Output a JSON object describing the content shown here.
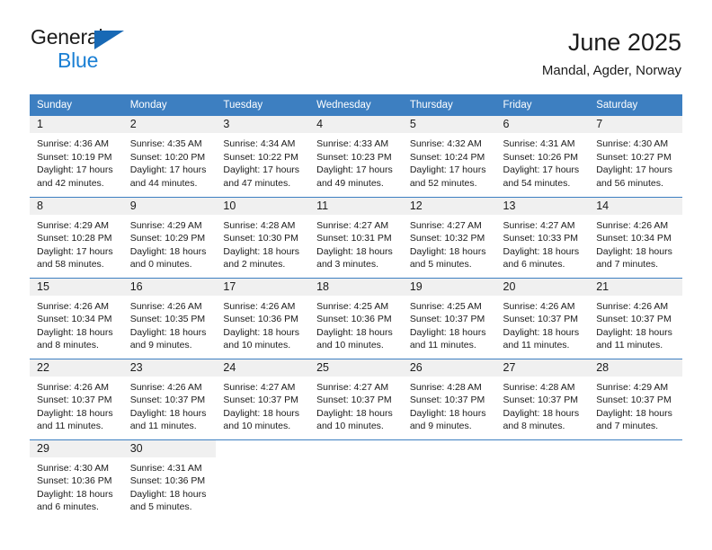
{
  "logo": {
    "word_one": "General",
    "word_two": "Blue",
    "triangle_icon": "triangle-icon",
    "accent_dark_blue": "#1869b5",
    "accent_blue": "#1a7fd4"
  },
  "header": {
    "title": "June 2025",
    "subtitle": "Mandal, Agder, Norway"
  },
  "theme": {
    "header_row_bg": "#3d7fc1",
    "header_row_text": "#ffffff",
    "daynum_band_bg": "#f0f0f0",
    "text": "#1b1b1b"
  },
  "calendar": {
    "weekday_headers": [
      "Sunday",
      "Monday",
      "Tuesday",
      "Wednesday",
      "Thursday",
      "Friday",
      "Saturday"
    ],
    "weeks": [
      [
        {
          "day": "1",
          "sunrise": "Sunrise: 4:36 AM",
          "sunset": "Sunset: 10:19 PM",
          "daylight": "Daylight: 17 hours and 42 minutes."
        },
        {
          "day": "2",
          "sunrise": "Sunrise: 4:35 AM",
          "sunset": "Sunset: 10:20 PM",
          "daylight": "Daylight: 17 hours and 44 minutes."
        },
        {
          "day": "3",
          "sunrise": "Sunrise: 4:34 AM",
          "sunset": "Sunset: 10:22 PM",
          "daylight": "Daylight: 17 hours and 47 minutes."
        },
        {
          "day": "4",
          "sunrise": "Sunrise: 4:33 AM",
          "sunset": "Sunset: 10:23 PM",
          "daylight": "Daylight: 17 hours and 49 minutes."
        },
        {
          "day": "5",
          "sunrise": "Sunrise: 4:32 AM",
          "sunset": "Sunset: 10:24 PM",
          "daylight": "Daylight: 17 hours and 52 minutes."
        },
        {
          "day": "6",
          "sunrise": "Sunrise: 4:31 AM",
          "sunset": "Sunset: 10:26 PM",
          "daylight": "Daylight: 17 hours and 54 minutes."
        },
        {
          "day": "7",
          "sunrise": "Sunrise: 4:30 AM",
          "sunset": "Sunset: 10:27 PM",
          "daylight": "Daylight: 17 hours and 56 minutes."
        }
      ],
      [
        {
          "day": "8",
          "sunrise": "Sunrise: 4:29 AM",
          "sunset": "Sunset: 10:28 PM",
          "daylight": "Daylight: 17 hours and 58 minutes."
        },
        {
          "day": "9",
          "sunrise": "Sunrise: 4:29 AM",
          "sunset": "Sunset: 10:29 PM",
          "daylight": "Daylight: 18 hours and 0 minutes."
        },
        {
          "day": "10",
          "sunrise": "Sunrise: 4:28 AM",
          "sunset": "Sunset: 10:30 PM",
          "daylight": "Daylight: 18 hours and 2 minutes."
        },
        {
          "day": "11",
          "sunrise": "Sunrise: 4:27 AM",
          "sunset": "Sunset: 10:31 PM",
          "daylight": "Daylight: 18 hours and 3 minutes."
        },
        {
          "day": "12",
          "sunrise": "Sunrise: 4:27 AM",
          "sunset": "Sunset: 10:32 PM",
          "daylight": "Daylight: 18 hours and 5 minutes."
        },
        {
          "day": "13",
          "sunrise": "Sunrise: 4:27 AM",
          "sunset": "Sunset: 10:33 PM",
          "daylight": "Daylight: 18 hours and 6 minutes."
        },
        {
          "day": "14",
          "sunrise": "Sunrise: 4:26 AM",
          "sunset": "Sunset: 10:34 PM",
          "daylight": "Daylight: 18 hours and 7 minutes."
        }
      ],
      [
        {
          "day": "15",
          "sunrise": "Sunrise: 4:26 AM",
          "sunset": "Sunset: 10:34 PM",
          "daylight": "Daylight: 18 hours and 8 minutes."
        },
        {
          "day": "16",
          "sunrise": "Sunrise: 4:26 AM",
          "sunset": "Sunset: 10:35 PM",
          "daylight": "Daylight: 18 hours and 9 minutes."
        },
        {
          "day": "17",
          "sunrise": "Sunrise: 4:26 AM",
          "sunset": "Sunset: 10:36 PM",
          "daylight": "Daylight: 18 hours and 10 minutes."
        },
        {
          "day": "18",
          "sunrise": "Sunrise: 4:25 AM",
          "sunset": "Sunset: 10:36 PM",
          "daylight": "Daylight: 18 hours and 10 minutes."
        },
        {
          "day": "19",
          "sunrise": "Sunrise: 4:25 AM",
          "sunset": "Sunset: 10:37 PM",
          "daylight": "Daylight: 18 hours and 11 minutes."
        },
        {
          "day": "20",
          "sunrise": "Sunrise: 4:26 AM",
          "sunset": "Sunset: 10:37 PM",
          "daylight": "Daylight: 18 hours and 11 minutes."
        },
        {
          "day": "21",
          "sunrise": "Sunrise: 4:26 AM",
          "sunset": "Sunset: 10:37 PM",
          "daylight": "Daylight: 18 hours and 11 minutes."
        }
      ],
      [
        {
          "day": "22",
          "sunrise": "Sunrise: 4:26 AM",
          "sunset": "Sunset: 10:37 PM",
          "daylight": "Daylight: 18 hours and 11 minutes."
        },
        {
          "day": "23",
          "sunrise": "Sunrise: 4:26 AM",
          "sunset": "Sunset: 10:37 PM",
          "daylight": "Daylight: 18 hours and 11 minutes."
        },
        {
          "day": "24",
          "sunrise": "Sunrise: 4:27 AM",
          "sunset": "Sunset: 10:37 PM",
          "daylight": "Daylight: 18 hours and 10 minutes."
        },
        {
          "day": "25",
          "sunrise": "Sunrise: 4:27 AM",
          "sunset": "Sunset: 10:37 PM",
          "daylight": "Daylight: 18 hours and 10 minutes."
        },
        {
          "day": "26",
          "sunrise": "Sunrise: 4:28 AM",
          "sunset": "Sunset: 10:37 PM",
          "daylight": "Daylight: 18 hours and 9 minutes."
        },
        {
          "day": "27",
          "sunrise": "Sunrise: 4:28 AM",
          "sunset": "Sunset: 10:37 PM",
          "daylight": "Daylight: 18 hours and 8 minutes."
        },
        {
          "day": "28",
          "sunrise": "Sunrise: 4:29 AM",
          "sunset": "Sunset: 10:37 PM",
          "daylight": "Daylight: 18 hours and 7 minutes."
        }
      ],
      [
        {
          "day": "29",
          "sunrise": "Sunrise: 4:30 AM",
          "sunset": "Sunset: 10:36 PM",
          "daylight": "Daylight: 18 hours and 6 minutes."
        },
        {
          "day": "30",
          "sunrise": "Sunrise: 4:31 AM",
          "sunset": "Sunset: 10:36 PM",
          "daylight": "Daylight: 18 hours and 5 minutes."
        },
        {
          "day": "",
          "sunrise": "",
          "sunset": "",
          "daylight": ""
        },
        {
          "day": "",
          "sunrise": "",
          "sunset": "",
          "daylight": ""
        },
        {
          "day": "",
          "sunrise": "",
          "sunset": "",
          "daylight": ""
        },
        {
          "day": "",
          "sunrise": "",
          "sunset": "",
          "daylight": ""
        },
        {
          "day": "",
          "sunrise": "",
          "sunset": "",
          "daylight": ""
        }
      ]
    ]
  }
}
